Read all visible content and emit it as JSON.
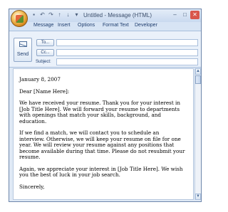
{
  "window": {
    "title": "Untitled - Message (HTML)",
    "qat_icons": [
      "save-icon",
      "undo-icon",
      "redo-icon",
      "up-arrow-icon",
      "down-arrow-icon",
      "customize-icon"
    ],
    "controls": {
      "minimize": "–",
      "maximize": "□",
      "close": "✕"
    }
  },
  "ribbon": {
    "tabs": [
      "Message",
      "Insert",
      "Options",
      "Format Text",
      "Developer"
    ]
  },
  "header": {
    "send_label": "Send",
    "to_label": "To...",
    "cc_label": "Cc...",
    "subject_label": "Subject:",
    "to_value": "",
    "cc_value": "",
    "subject_value": ""
  },
  "letter": {
    "date": "January 8, 2007",
    "salutation": "Dear [Name Here]:",
    "paragraph1": "We have received your resume. Thank you for your interest in [Job Title Here]. We will forward your resume to departments with openings that match your skills, background, and education.",
    "paragraph2": "If we find a match, we will contact you to schedule an interview. Otherwise, we will keep your resume on file for one year. We will review your resume against any positions that become available during that time. Please do not resubmit your resume.",
    "paragraph3": "Again, we appreciate your interest in [Job Title Here]. We wish you the best of luck in your job search.",
    "closing": "Sincerely,"
  },
  "colors": {
    "chrome": "#dfe9f5",
    "accent": "#1e3d6e",
    "close": "#d9574b"
  }
}
